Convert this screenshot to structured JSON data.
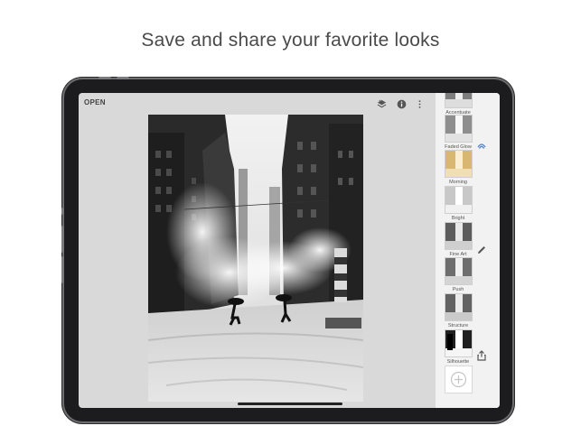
{
  "headline": "Save and share your favorite looks",
  "toolbar": {
    "open_label": "OPEN",
    "icons": [
      "layers-icon",
      "info-icon",
      "more-vert-icon"
    ]
  },
  "looks": [
    {
      "label": "Accentuate",
      "tone": "#7d7d7d"
    },
    {
      "label": "Faded Glow",
      "tone": "#8e8e8e"
    },
    {
      "label": "Morning",
      "tone": "#d8b771"
    },
    {
      "label": "Bright",
      "tone": "#c8c8c8"
    },
    {
      "label": "Fine Art",
      "tone": "#5c5c5c"
    },
    {
      "label": "Push",
      "tone": "#6e6e6e"
    },
    {
      "label": "Structure",
      "tone": "#626262"
    },
    {
      "label": "Silhouette",
      "tone": "#202020"
    }
  ],
  "side_tools": [
    "looks-icon",
    "edit-pencil-icon",
    "share-icon"
  ],
  "colors": {
    "accent": "#4a7ec9",
    "panel": "#f2f2f2",
    "canvas": "#d9d9d9"
  }
}
